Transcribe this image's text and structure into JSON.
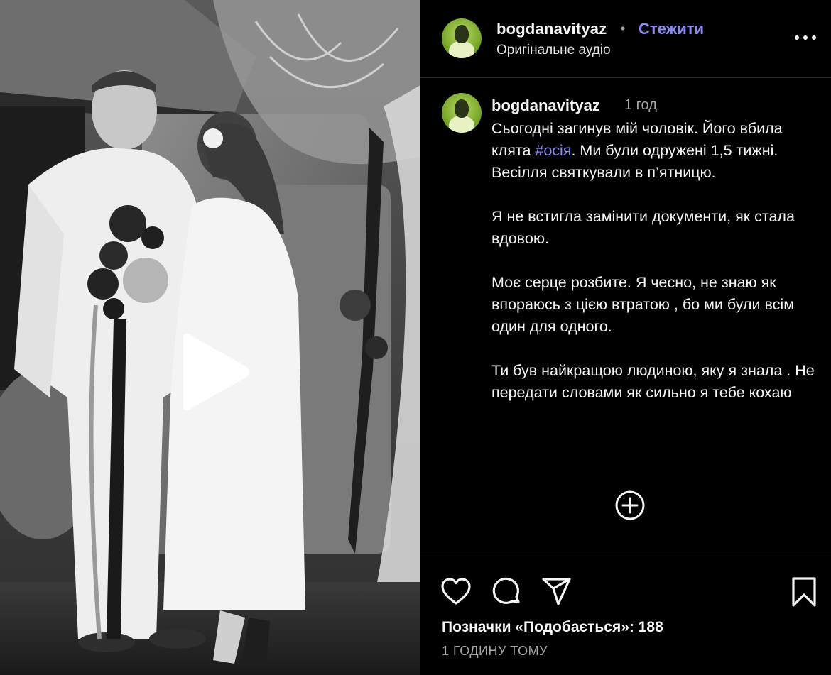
{
  "post": {
    "username": "bogdanavityaz",
    "separator": "•",
    "follow_label": "Стежити",
    "audio_label": "Оригінальне аудіо"
  },
  "caption": {
    "username": "bogdanavityaz",
    "time": "1 год",
    "p1_before": "Сьогодні загинув мій чоловік. Його вбила клята ",
    "hashtag": "#осія",
    "p1_after": ". Ми були одружені 1,5 тижні. Весілля святкували в п’ятницю.",
    "p2": "Я не встигла замінити документи, як стала вдовою.",
    "p3": "Моє серце розбите. Я чесно, не знаю як впораюсь з цією втратою , бо ми були всім один для одного.",
    "p4": "Ти був найкращою людиною, яку я знала . Не передати словами як сильно я тебе кохаю"
  },
  "footer": {
    "likes_text": "Позначки «Подобається»: 188",
    "time_ago": "1 ГОДИНУ ТОМУ"
  },
  "icons": {
    "more": "more-horizontal-icon",
    "play": "play-icon",
    "load_more": "plus-circle-icon",
    "like": "heart-icon",
    "comment": "comment-icon",
    "share": "send-icon",
    "save": "bookmark-icon"
  },
  "colors": {
    "background": "#000000",
    "accent": "#8a8bf6",
    "secondary_text": "#a8a8a8",
    "divider": "#262626"
  }
}
